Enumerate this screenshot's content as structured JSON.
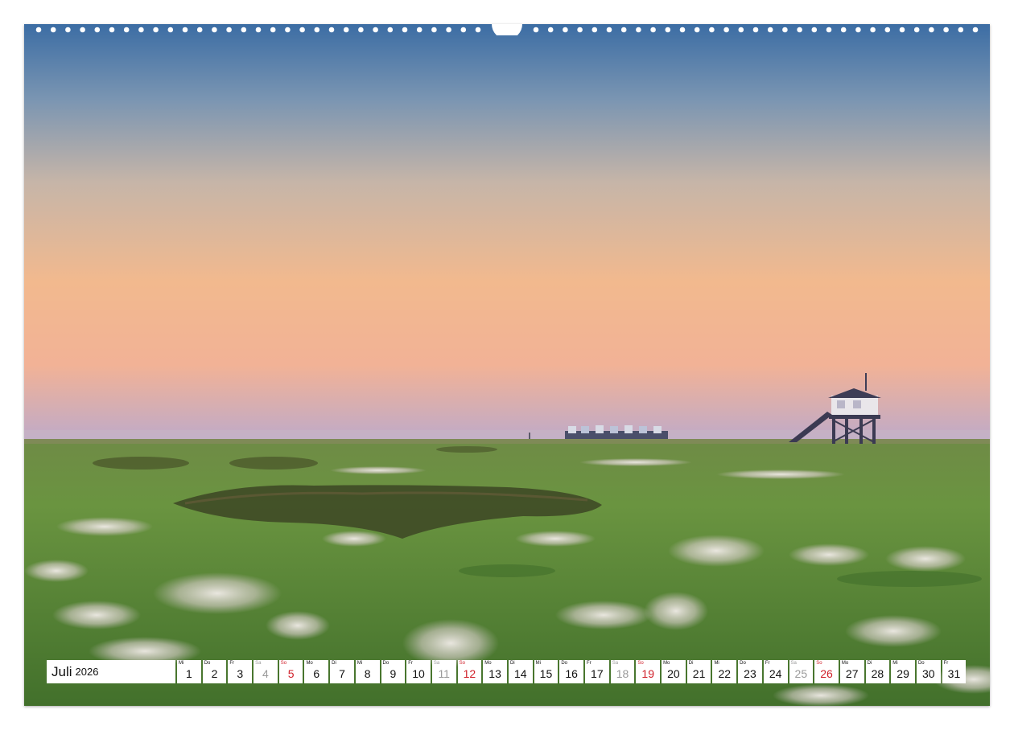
{
  "calendar": {
    "month": "Juli",
    "year": "2026",
    "days": [
      {
        "abbr": "Mi",
        "num": "1",
        "type": "weekday"
      },
      {
        "abbr": "Do",
        "num": "2",
        "type": "weekday"
      },
      {
        "abbr": "Fr",
        "num": "3",
        "type": "weekday"
      },
      {
        "abbr": "Sa",
        "num": "4",
        "type": "sat"
      },
      {
        "abbr": "So",
        "num": "5",
        "type": "sun"
      },
      {
        "abbr": "Mo",
        "num": "6",
        "type": "weekday"
      },
      {
        "abbr": "Di",
        "num": "7",
        "type": "weekday"
      },
      {
        "abbr": "Mi",
        "num": "8",
        "type": "weekday"
      },
      {
        "abbr": "Do",
        "num": "9",
        "type": "weekday"
      },
      {
        "abbr": "Fr",
        "num": "10",
        "type": "weekday"
      },
      {
        "abbr": "Sa",
        "num": "11",
        "type": "sat"
      },
      {
        "abbr": "So",
        "num": "12",
        "type": "sun"
      },
      {
        "abbr": "Mo",
        "num": "13",
        "type": "weekday"
      },
      {
        "abbr": "Di",
        "num": "14",
        "type": "weekday"
      },
      {
        "abbr": "Mi",
        "num": "15",
        "type": "weekday"
      },
      {
        "abbr": "Do",
        "num": "16",
        "type": "weekday"
      },
      {
        "abbr": "Fr",
        "num": "17",
        "type": "weekday"
      },
      {
        "abbr": "Sa",
        "num": "18",
        "type": "sat"
      },
      {
        "abbr": "So",
        "num": "19",
        "type": "sun"
      },
      {
        "abbr": "Mo",
        "num": "20",
        "type": "weekday"
      },
      {
        "abbr": "Di",
        "num": "21",
        "type": "weekday"
      },
      {
        "abbr": "Mi",
        "num": "22",
        "type": "weekday"
      },
      {
        "abbr": "Do",
        "num": "23",
        "type": "weekday"
      },
      {
        "abbr": "Fr",
        "num": "24",
        "type": "weekday"
      },
      {
        "abbr": "Sa",
        "num": "25",
        "type": "sat"
      },
      {
        "abbr": "So",
        "num": "26",
        "type": "sun"
      },
      {
        "abbr": "Mo",
        "num": "27",
        "type": "weekday"
      },
      {
        "abbr": "Di",
        "num": "28",
        "type": "weekday"
      },
      {
        "abbr": "Mi",
        "num": "29",
        "type": "weekday"
      },
      {
        "abbr": "Do",
        "num": "30",
        "type": "weekday"
      },
      {
        "abbr": "Fr",
        "num": "31",
        "type": "weekday"
      }
    ]
  },
  "colors": {
    "sunday": "#d0202a",
    "saturday": "#9a9a9a",
    "sky_top": "#3d6fa6",
    "sky_horizon": "#f0b287",
    "meadow": "#5e8a3a"
  },
  "photo": {
    "subject": "salt marsh meadow at dawn with stilt houses"
  }
}
